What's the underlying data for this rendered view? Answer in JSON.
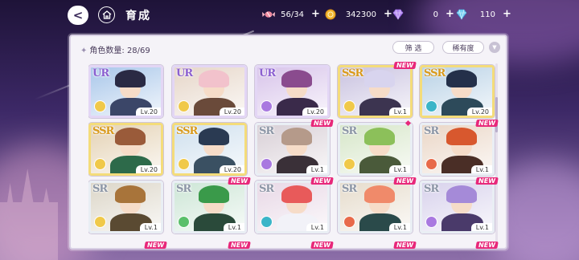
{
  "header": {
    "back_label": "<",
    "title": "育成",
    "resources": [
      {
        "name": "candy-icon",
        "value": "56/34",
        "color": "#e8738a"
      },
      {
        "name": "gold-coin-icon",
        "value": "342300",
        "color": "#f2b632"
      },
      {
        "name": "purple-gem-icon",
        "value": "0",
        "color": "#b58bf0"
      },
      {
        "name": "blue-gem-icon",
        "value": "110",
        "color": "#7ad0f2"
      }
    ],
    "plus": "+"
  },
  "panel": {
    "count_label": "角色数量: 28/69",
    "filter_label": "筛 选",
    "sort_label": "稀有度",
    "sort_toggle": "▼"
  },
  "new_badge": "NEW",
  "cards": [
    {
      "rarity": "UR",
      "level": "Lv.20",
      "new": false,
      "attr": "#f0c94a",
      "bg": "#a9c7ea",
      "hair": "#2a2a44",
      "body": "#3b4668"
    },
    {
      "rarity": "UR",
      "level": "Lv.20",
      "new": false,
      "attr": "#f0c94a",
      "bg": "#e6d6c8",
      "hair": "#f2c2cc",
      "body": "#6a4a3a"
    },
    {
      "rarity": "UR",
      "level": "Lv.20",
      "new": false,
      "attr": "#a979e0",
      "bg": "#d8c4ea",
      "hair": "#8a4b8e",
      "body": "#3a2a4a"
    },
    {
      "rarity": "SSR",
      "level": "Lv.1",
      "new": true,
      "attr": "#f0c94a",
      "bg": "#c9c2e0",
      "hair": "#d8d4ee",
      "body": "#3c3450"
    },
    {
      "rarity": "SSR",
      "level": "Lv.20",
      "new": false,
      "attr": "#3bb5c8",
      "bg": "#b9d2e6",
      "hair": "#24304a",
      "body": "#2d4a5a"
    },
    {
      "rarity": "SSR",
      "level": "Lv.20",
      "new": false,
      "attr": "#f0c94a",
      "bg": "#e4d2b4",
      "hair": "#9a5b3a",
      "body": "#2d6a4a"
    },
    {
      "rarity": "SSR",
      "level": "Lv.20",
      "new": false,
      "attr": "#f0c94a",
      "bg": "#cfe0ee",
      "hair": "#2a3a52",
      "body": "#3a5062"
    },
    {
      "rarity": "SR",
      "level": "Lv.1",
      "new": true,
      "attr": "#a979e0",
      "bg": "#d8cfd6",
      "hair": "#b59a8a",
      "body": "#3a3038"
    },
    {
      "rarity": "SR",
      "level": "Lv.1",
      "new": false,
      "attr": "#f0c94a",
      "bg": "#d6e6c8",
      "hair": "#8cc05a",
      "body": "#4a5a3a"
    },
    {
      "rarity": "SR",
      "level": "Lv.1",
      "new": true,
      "attr": "#e86a4a",
      "bg": "#ead6c6",
      "hair": "#d8582e",
      "body": "#4a2e26"
    },
    {
      "rarity": "SR",
      "level": "Lv.1",
      "new": false,
      "attr": "#f0c94a",
      "bg": "#dcd6c8",
      "hair": "#a8743a",
      "body": "#5a4a32"
    },
    {
      "rarity": "SR",
      "level": "Lv.1",
      "new": true,
      "attr": "#5abf6a",
      "bg": "#cde6d6",
      "hair": "#3a9a4a",
      "body": "#2a4a3a"
    },
    {
      "rarity": "SR",
      "level": "Lv.1",
      "new": true,
      "attr": "#3bb5c8",
      "bg": "#e8d8e6",
      "hair": "#e85a5a",
      "body": "#f2f2f8"
    },
    {
      "rarity": "SR",
      "level": "Lv.1",
      "new": true,
      "attr": "#e86a4a",
      "bg": "#e6dccc",
      "hair": "#f08a6a",
      "body": "#2a4a4a"
    },
    {
      "rarity": "SR",
      "level": "Lv.1",
      "new": true,
      "attr": "#a979e0",
      "bg": "#d8d2ec",
      "hair": "#a58ad8",
      "body": "#4a3a6a"
    }
  ],
  "peek_new_badges": [
    "NEW",
    "NEW",
    "NEW",
    "NEW",
    "NEW"
  ]
}
